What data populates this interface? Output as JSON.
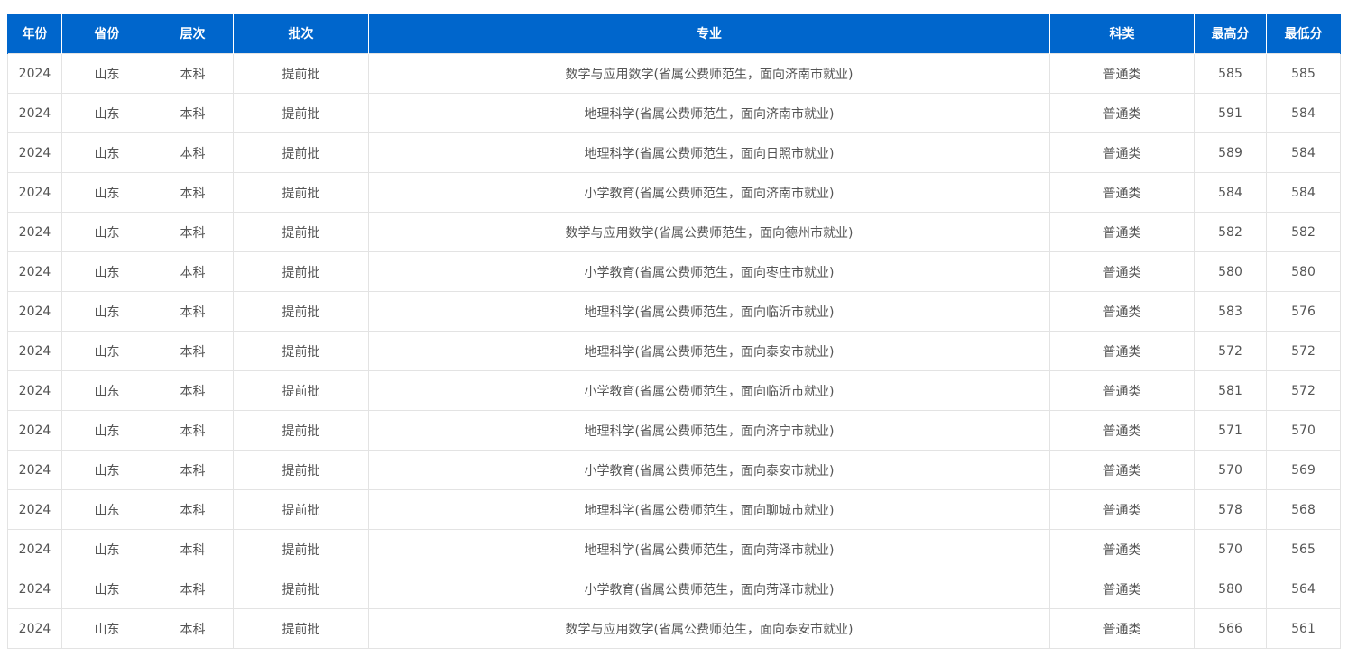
{
  "table": {
    "headers": [
      "年份",
      "省份",
      "层次",
      "批次",
      "专业",
      "科类",
      "最高分",
      "最低分"
    ],
    "rows": [
      [
        "2024",
        "山东",
        "本科",
        "提前批",
        "数学与应用数学(省属公费师范生，面向济南市就业)",
        "普通类",
        "585",
        "585"
      ],
      [
        "2024",
        "山东",
        "本科",
        "提前批",
        "地理科学(省属公费师范生，面向济南市就业)",
        "普通类",
        "591",
        "584"
      ],
      [
        "2024",
        "山东",
        "本科",
        "提前批",
        "地理科学(省属公费师范生，面向日照市就业)",
        "普通类",
        "589",
        "584"
      ],
      [
        "2024",
        "山东",
        "本科",
        "提前批",
        "小学教育(省属公费师范生，面向济南市就业)",
        "普通类",
        "584",
        "584"
      ],
      [
        "2024",
        "山东",
        "本科",
        "提前批",
        "数学与应用数学(省属公费师范生，面向德州市就业)",
        "普通类",
        "582",
        "582"
      ],
      [
        "2024",
        "山东",
        "本科",
        "提前批",
        "小学教育(省属公费师范生，面向枣庄市就业)",
        "普通类",
        "580",
        "580"
      ],
      [
        "2024",
        "山东",
        "本科",
        "提前批",
        "地理科学(省属公费师范生，面向临沂市就业)",
        "普通类",
        "583",
        "576"
      ],
      [
        "2024",
        "山东",
        "本科",
        "提前批",
        "地理科学(省属公费师范生，面向泰安市就业)",
        "普通类",
        "572",
        "572"
      ],
      [
        "2024",
        "山东",
        "本科",
        "提前批",
        "小学教育(省属公费师范生，面向临沂市就业)",
        "普通类",
        "581",
        "572"
      ],
      [
        "2024",
        "山东",
        "本科",
        "提前批",
        "地理科学(省属公费师范生，面向济宁市就业)",
        "普通类",
        "571",
        "570"
      ],
      [
        "2024",
        "山东",
        "本科",
        "提前批",
        "小学教育(省属公费师范生，面向泰安市就业)",
        "普通类",
        "570",
        "569"
      ],
      [
        "2024",
        "山东",
        "本科",
        "提前批",
        "地理科学(省属公费师范生，面向聊城市就业)",
        "普通类",
        "578",
        "568"
      ],
      [
        "2024",
        "山东",
        "本科",
        "提前批",
        "地理科学(省属公费师范生，面向菏泽市就业)",
        "普通类",
        "570",
        "565"
      ],
      [
        "2024",
        "山东",
        "本科",
        "提前批",
        "小学教育(省属公费师范生，面向菏泽市就业)",
        "普通类",
        "580",
        "564"
      ],
      [
        "2024",
        "山东",
        "本科",
        "提前批",
        "数学与应用数学(省属公费师范生，面向泰安市就业)",
        "普通类",
        "566",
        "561"
      ]
    ]
  },
  "colors": {
    "header_bg": "#0066cc",
    "header_text": "#ffffff",
    "cell_text": "#555555",
    "border": "#e3e3e3"
  }
}
